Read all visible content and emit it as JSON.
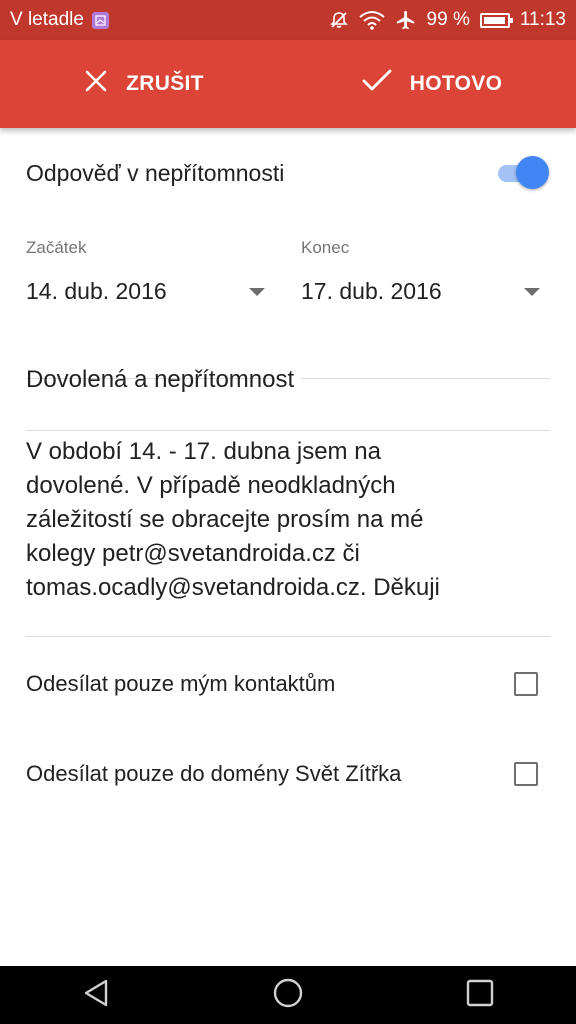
{
  "status_bar": {
    "carrier_text": "V letadle",
    "battery_percent": "99 %",
    "time": "11:13",
    "icons": [
      "app-icon",
      "mute-icon",
      "wifi-icon",
      "airplane-icon",
      "battery-icon"
    ]
  },
  "app_bar": {
    "cancel_label": "ZRUŠIT",
    "done_label": "HOTOVO"
  },
  "form": {
    "toggle_label": "Odpověď v nepřítomnosti",
    "toggle_on": true,
    "start": {
      "caption": "Začátek",
      "value": "14. dub. 2016"
    },
    "end": {
      "caption": "Konec",
      "value": "17. dub. 2016"
    },
    "subject": "Dovolená a nepřítomnost",
    "message_lines": [
      "V období 14. - 17. dubna jsem na",
      "dovolené. V případě neodkladných",
      "záležitostí se obracejte prosím na mé",
      "kolegy petr@svetandroida.cz či",
      "tomas.ocadly@svetandroida.cz. Děkuji"
    ],
    "option_contacts_label": "Odesílat pouze mým kontaktům",
    "option_contacts_checked": false,
    "option_domain_label": "Odesílat pouze do domény Svět Zítřka",
    "option_domain_checked": false
  },
  "colors": {
    "status_bar": "#c0382b",
    "app_bar": "#db4437",
    "accent": "#4285f4"
  }
}
